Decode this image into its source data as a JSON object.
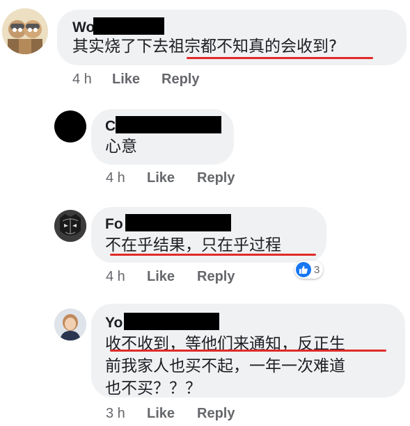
{
  "comments": [
    {
      "name": "Wo",
      "text": "其实烧了下去祖宗都不知真的会收到?",
      "time": "4 h",
      "like": "Like",
      "reply": "Reply"
    },
    {
      "name": "C",
      "text": "心意",
      "time": "4 h",
      "like": "Like",
      "reply": "Reply"
    },
    {
      "name": "Fo",
      "text": "不在乎结果，只在乎过程",
      "time": "4 h",
      "like": "Like",
      "reply": "Reply",
      "reaction_count": "3"
    },
    {
      "name": "Yo",
      "lines": [
        "收不收到，等他们来通知，反正生",
        "前我家人也买不起，一年一次难道",
        "也不买？？？"
      ],
      "time": "3 h",
      "like": "Like",
      "reply": "Reply"
    }
  ],
  "colors": {
    "bubble": "#f0f1f3",
    "underline": "#e02a2a",
    "like_blue": "#1877f2",
    "meta_gray": "#65676b"
  }
}
